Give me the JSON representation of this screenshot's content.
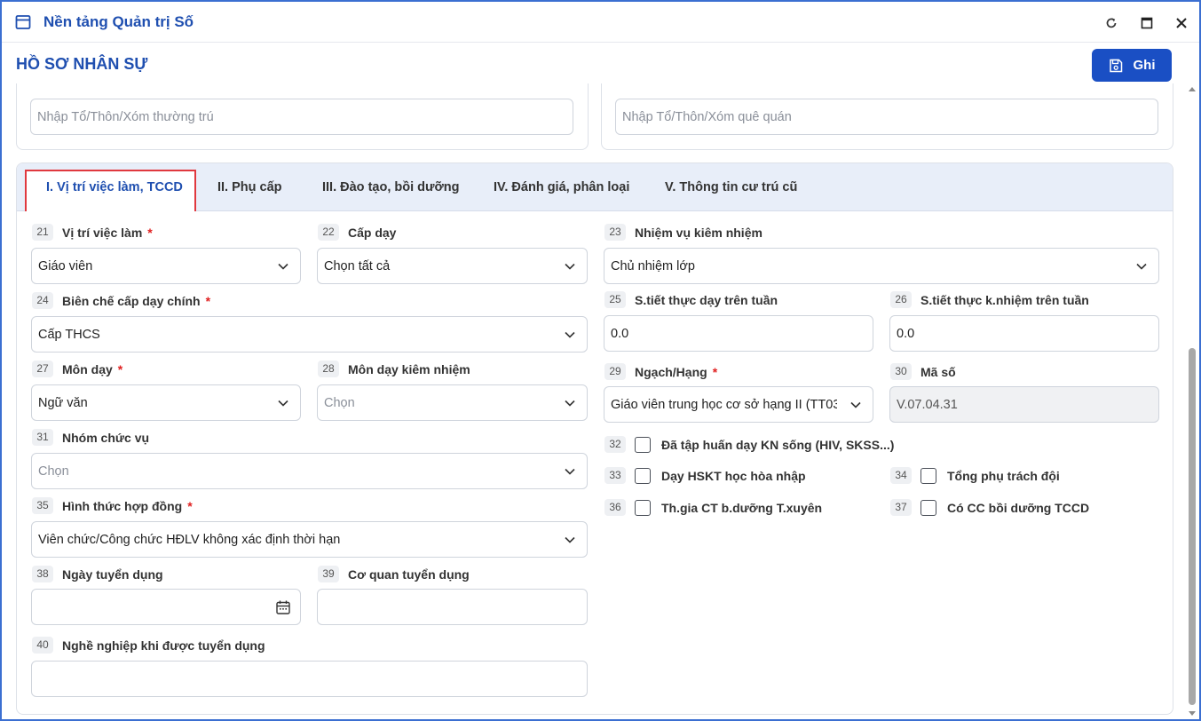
{
  "window": {
    "app_title": "Nền tảng Quản trị Số"
  },
  "header": {
    "page_title": "HỒ SƠ NHÂN SỰ",
    "save_label": "Ghi"
  },
  "top_fields": {
    "left_placeholder": "Nhập Tổ/Thôn/Xóm thường trú",
    "right_placeholder": "Nhập Tổ/Thôn/Xóm quê quán"
  },
  "tabs": [
    {
      "label": "I. Vị trí việc làm, TCCD",
      "active": true
    },
    {
      "label": "II. Phụ cấp",
      "active": false
    },
    {
      "label": "III. Đào tạo, bồi dưỡng",
      "active": false
    },
    {
      "label": "IV. Đánh giá, phân loại",
      "active": false
    },
    {
      "label": "V. Thông tin cư trú cũ",
      "active": false
    }
  ],
  "fields": {
    "f21": {
      "num": "21",
      "label": "Vị trí việc làm",
      "value": "Giáo viên"
    },
    "f22": {
      "num": "22",
      "label": "Cấp dạy",
      "value": "Chọn tất cả"
    },
    "f23": {
      "num": "23",
      "label": "Nhiệm vụ kiêm nhiệm",
      "value": "Chủ nhiệm lớp"
    },
    "f24": {
      "num": "24",
      "label": "Biên chế cấp dạy chính",
      "value": "Cấp THCS"
    },
    "f25": {
      "num": "25",
      "label": "S.tiết thực dạy trên tuần",
      "value": "0.0"
    },
    "f26": {
      "num": "26",
      "label": "S.tiết thực k.nhiệm trên tuần",
      "value": "0.0"
    },
    "f27": {
      "num": "27",
      "label": "Môn dạy",
      "value": "Ngữ văn"
    },
    "f28": {
      "num": "28",
      "label": "Môn dạy kiêm nhiệm",
      "value": "Chọn"
    },
    "f29": {
      "num": "29",
      "label": "Ngạch/Hạng",
      "value": "Giáo viên trung học cơ sở hạng II (TT03)"
    },
    "f30": {
      "num": "30",
      "label": "Mã số",
      "value": "V.07.04.31"
    },
    "f31": {
      "num": "31",
      "label": "Nhóm chức vụ",
      "value": "Chọn"
    },
    "f32": {
      "num": "32",
      "label": "Đã tập huấn dạy KN sống (HIV, SKSS...)",
      "checked": false
    },
    "f33": {
      "num": "33",
      "label": "Dạy HSKT học hòa nhập",
      "checked": false
    },
    "f34": {
      "num": "34",
      "label": "Tổng phụ trách đội",
      "checked": false
    },
    "f35": {
      "num": "35",
      "label": "Hình thức hợp đồng",
      "value": "Viên chức/Công chức HĐLV không xác định thời hạn"
    },
    "f36": {
      "num": "36",
      "label": "Th.gia CT b.dưỡng T.xuyên",
      "checked": false
    },
    "f37": {
      "num": "37",
      "label": "Có CC bồi dưỡng TCCD",
      "checked": false
    },
    "f38": {
      "num": "38",
      "label": "Ngày tuyển dụng",
      "value": ""
    },
    "f39": {
      "num": "39",
      "label": "Cơ quan tuyển dụng",
      "value": ""
    },
    "f40": {
      "num": "40",
      "label": "Nghề nghiệp khi được tuyển dụng",
      "value": ""
    }
  },
  "required_mark": "*",
  "colors": {
    "primary": "#1a4fc4",
    "title": "#1f4fb0",
    "active_tab_outline": "#e0383e",
    "tabbar_bg": "#e8eef9",
    "required": "#e02020"
  },
  "icons": {
    "app": "window-icon",
    "refresh": "refresh-icon",
    "maximize": "maximize-icon",
    "close": "close-icon",
    "save": "floppy-disk-icon",
    "dropdown": "chevron-down-icon",
    "date": "calendar-icon"
  }
}
